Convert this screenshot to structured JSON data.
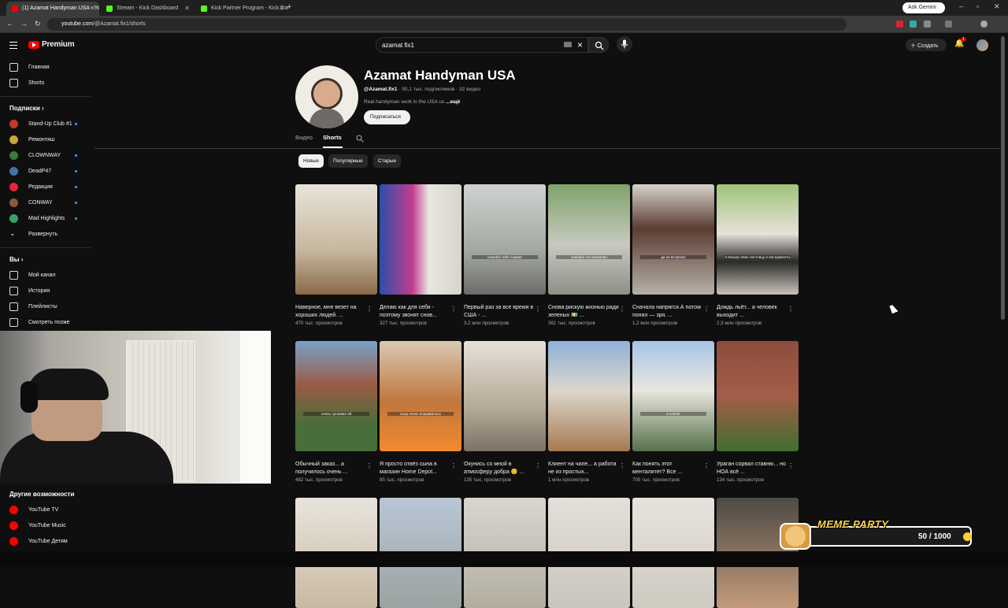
{
  "browser": {
    "tabs": [
      {
        "label": "(1) Azamat Handyman USA - YouTube",
        "color": "#ff0000",
        "active": true
      },
      {
        "label": "Stream - Kick Dashboard",
        "color": "#53fc18",
        "active": false
      },
      {
        "label": "Kick Partner Program - Kick Dash",
        "color": "#53fc18",
        "active": false
      }
    ],
    "url_site": "youtube.com",
    "url_path": "/@Azamat.fix1/shorts",
    "ask_gemini": "Ask Gemini"
  },
  "header": {
    "brand": "Premium",
    "search_value": "azamat fix1",
    "create_label": "Создать",
    "notifications_badge": "1"
  },
  "sidebar": {
    "main": [
      {
        "label": "Главная",
        "icon": "home-icon"
      },
      {
        "label": "Shorts",
        "icon": "shorts-icon"
      }
    ],
    "subscriptions_title": "Подписки",
    "subscriptions": [
      {
        "label": "Stand-Up Club #1",
        "color": "#c0392b",
        "dot": true
      },
      {
        "label": "Ремонтяш",
        "color": "#caa53b",
        "dot": false
      },
      {
        "label": "CLOWNWAY",
        "color": "#3e7a3a",
        "dot": true
      },
      {
        "label": "DeadP47",
        "color": "#4a6fa5",
        "dot": true
      },
      {
        "label": "Редакция",
        "color": "#e5233a",
        "dot": true
      },
      {
        "label": "CONWAY",
        "color": "#8a5a3c",
        "dot": true
      },
      {
        "label": "Mad Highlights",
        "color": "#3aa06a",
        "dot": true
      }
    ],
    "expand_label": "Развернуть",
    "you_title": "Вы",
    "you_items": [
      {
        "label": "Мой канал",
        "icon": "channel-icon"
      },
      {
        "label": "История",
        "icon": "history-icon"
      },
      {
        "label": "Плейлисты",
        "icon": "playlist-icon"
      },
      {
        "label": "Смотреть позже",
        "icon": "watch-later-icon"
      }
    ],
    "more_title": "Другие возможности",
    "more_items": [
      {
        "label": "YouTube TV"
      },
      {
        "label": "YouTube Music"
      },
      {
        "label": "YouTube Детям"
      }
    ]
  },
  "channel": {
    "name": "Azamat Handyman USA",
    "handle": "@Azamat.fix1",
    "stats": " · 50,1 тыс. подписчиков · 32 видео",
    "description": "Real handyman work in the USA us ",
    "more": "...ещё",
    "subscribe_label": "Подписаться",
    "tabs": [
      "Видео",
      "Shorts"
    ],
    "chips": [
      "Новые",
      "Популярные",
      "Старые"
    ]
  },
  "shorts": [
    {
      "title": "Наверное, мне везет на хороших людей. ...",
      "views": "470 тыс. просмотров",
      "caption": "",
      "bg": "linear-gradient(180deg,#e8e4da,#c6b79f 60%,#8a6a48)"
    },
    {
      "title": "Делаю как для себя - поэтому звонят снов...",
      "views": "327 тыс. просмотров",
      "caption": "",
      "bg": "linear-gradient(90deg,#2b4fa8,#c23c8e 40%,#e8e6e0 60%,#d8d4cc)"
    },
    {
      "title": "Первый раз за все время в США - ...",
      "views": "3,2 млн просмотров",
      "caption": "спасибо тебе Азамат",
      "bg": "linear-gradient(180deg,#cfd2cf,#a4a8a3 60%,#6c6c68)"
    },
    {
      "title": "Снова рискую жизнью ради зеленых 💵 ...",
      "views": "361 тыс. просмотров",
      "caption": "спасибо что позвонил",
      "bg": "linear-gradient(180deg,#7fa36a,#c7c9c0 55%,#8d8f88)"
    },
    {
      "title": "Сначала напрягся.А потом понял — зря. ...",
      "views": "1,2 млн просмотров",
      "caption": "да не встретил",
      "bg": "linear-gradient(180deg,#d7d2cb,#5a3d33 40%,#b7b0a6)"
    },
    {
      "title": "Дождь льёт... а человек выходит ...",
      "views": "2,3 млн просмотров",
      "caption": "я возьму свою лестницу и инструменты",
      "bg": "linear-gradient(180deg,#9fc37a,#e6e3da 45%,#2a2a2a 70%,#c9c4ba)"
    },
    {
      "title": "Обычный заказ... а получилось очень ...",
      "views": "482 тыс. просмотров",
      "caption": "очень пугливая ой",
      "bg": "linear-gradient(180deg,#7aa0c8,#9a5b46 40%,#4a6e3a 75%)"
    },
    {
      "title": "Я просто отвёз сына в магазин Home Depot...",
      "views": "85 тыс. просмотров",
      "caption": "сыну очень понравилось",
      "bg": "linear-gradient(180deg,#d9c9b3,#c0763c 55%,#f28a2f)"
    },
    {
      "title": "Окунись со мной в атмосферу добра 😊 ...",
      "views": "135 тыс. просмотров",
      "caption": "",
      "bg": "linear-gradient(180deg,#e6e1d8,#b6aa97 60%,#7c7266)"
    },
    {
      "title": "Клиент на чиле... а работа не из простых...",
      "views": "1 млн просмотров",
      "caption": "",
      "bg": "linear-gradient(180deg,#8fb0d8,#dcd7cc 45%,#a57a52)"
    },
    {
      "title": "Как понять этот менталитет? Все ...",
      "views": "705 тыс. просмотров",
      "caption": "и платит",
      "bg": "linear-gradient(180deg,#a7c4e6,#e9e6de 45%,#56704a)"
    },
    {
      "title": "Ураган сорвал ставню... но НОА всё ...",
      "views": "134 тыс. просмотров",
      "caption": "",
      "bg": "linear-gradient(180deg,#8c4d3d,#a45d48 50%,#3f6e30)"
    },
    {
      "title": "",
      "views": "",
      "caption": "",
      "bg": "linear-gradient(180deg,#e8e4dc,#c9b9a3)"
    },
    {
      "title": "",
      "views": "",
      "caption": "",
      "bg": "linear-gradient(180deg,#b9c6d6,#9aa3a0)"
    },
    {
      "title": "",
      "views": "",
      "caption": "",
      "bg": "linear-gradient(180deg,#d8d6cf,#b2ad9f)"
    },
    {
      "title": "",
      "views": "",
      "caption": "",
      "bg": "linear-gradient(180deg,#e3e0d9,#cac6bd)"
    },
    {
      "title": "",
      "views": "",
      "caption": "",
      "bg": "linear-gradient(180deg,#e6e3dd,#cfcac0)"
    },
    {
      "title": "",
      "views": "",
      "caption": "",
      "bg": "linear-gradient(180deg,#4c4a45,#c49a7a)"
    }
  ],
  "widget": {
    "title": "MEME PARTY",
    "count": "50 / 1000"
  }
}
